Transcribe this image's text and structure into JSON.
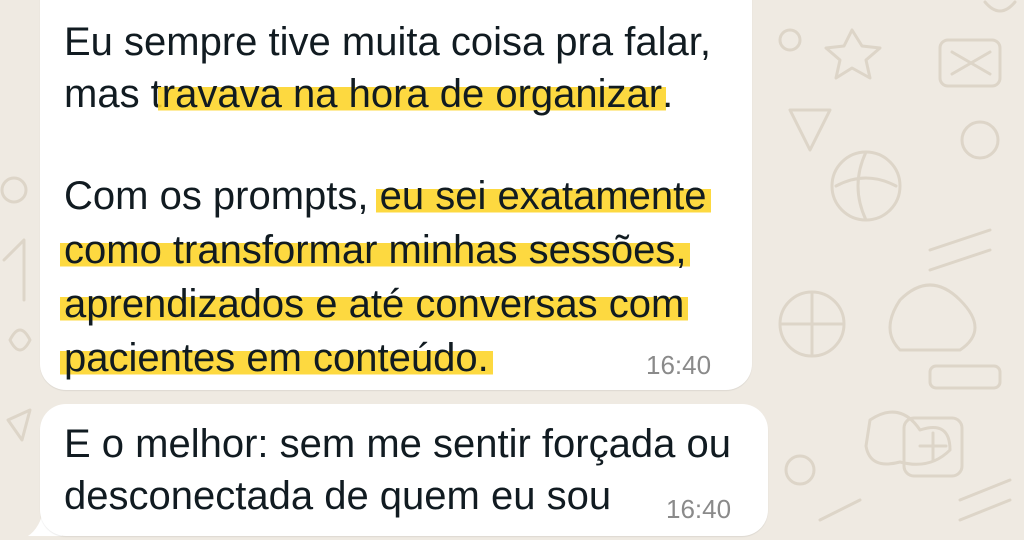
{
  "chat": {
    "messages": [
      {
        "paragraph1": {
          "line1": "Eu sempre tive muita coisa pra falar,",
          "line2_pre": "mas t",
          "line2_hl": "ravava na hora de organizar",
          "line2_post": "."
        },
        "paragraph2": {
          "line1_pre": "Com os prompts, ",
          "line1_hl": "eu sei exatamente",
          "line2": "como transformar minhas sessões,",
          "line3": "aprendizados e até conversas com",
          "line4": "pacientes em conteúdo."
        },
        "time": "16:40"
      },
      {
        "line1": "E o melhor: sem me sentir forçada ou",
        "line2": "desconectada de quem eu sou",
        "time": "16:40"
      }
    ]
  },
  "colors": {
    "wallpaper": "#efeae2",
    "bubble": "#ffffff",
    "highlight": "#fdd426",
    "text": "#111b21",
    "timestamp": "#8a8a8a"
  }
}
